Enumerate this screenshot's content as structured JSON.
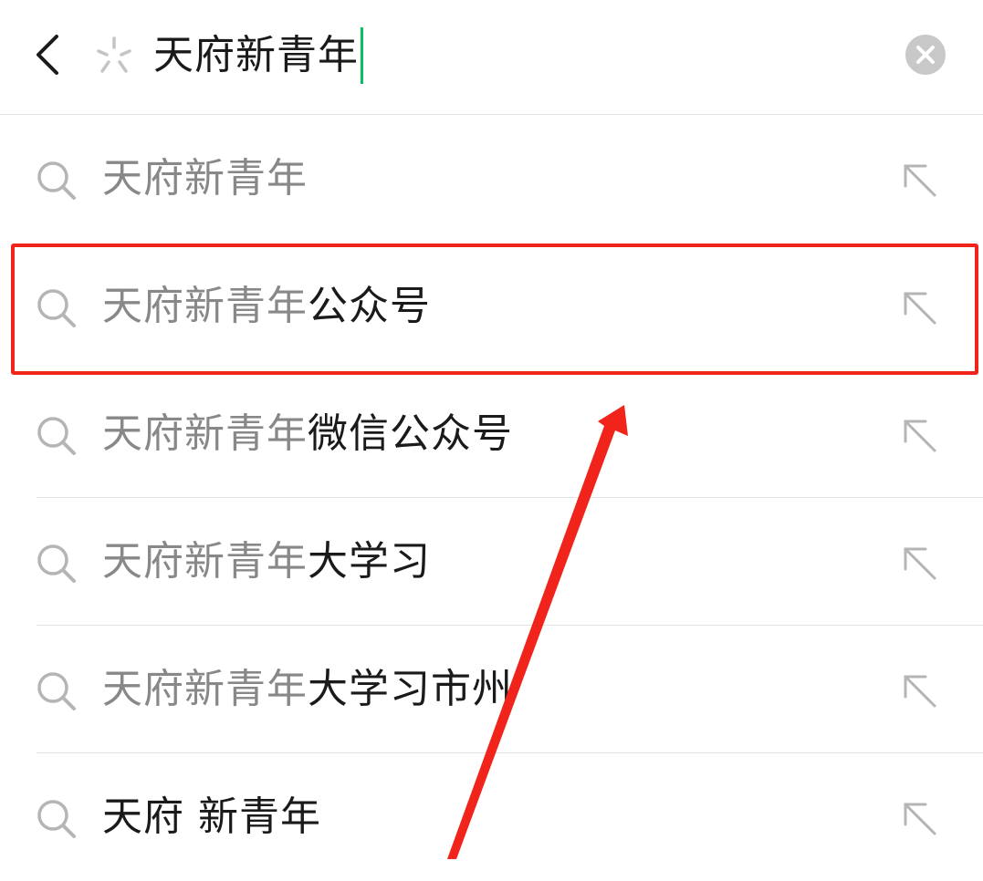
{
  "search": {
    "query": "天府新青年"
  },
  "suggestions": [
    {
      "match": "天府新青年",
      "rest": ""
    },
    {
      "match": "天府新青年",
      "rest": "公众号"
    },
    {
      "match": "天府新青年",
      "rest": "微信公众号"
    },
    {
      "match": "天府新青年",
      "rest": "大学习"
    },
    {
      "match": "天府新青年",
      "rest": "大学习市州"
    },
    {
      "match": "",
      "rest": "天府 新青年"
    }
  ],
  "colors": {
    "accent": "#07c160",
    "annotation": "#f0241b",
    "matched_text": "#888888",
    "primary_text": "#1a1a1a"
  },
  "icons": {
    "back": "chevron-left-icon",
    "loading": "loading-spinner-icon",
    "clear": "clear-circle-icon",
    "suggestion": "search-icon",
    "fill": "arrow-up-left-icon"
  }
}
